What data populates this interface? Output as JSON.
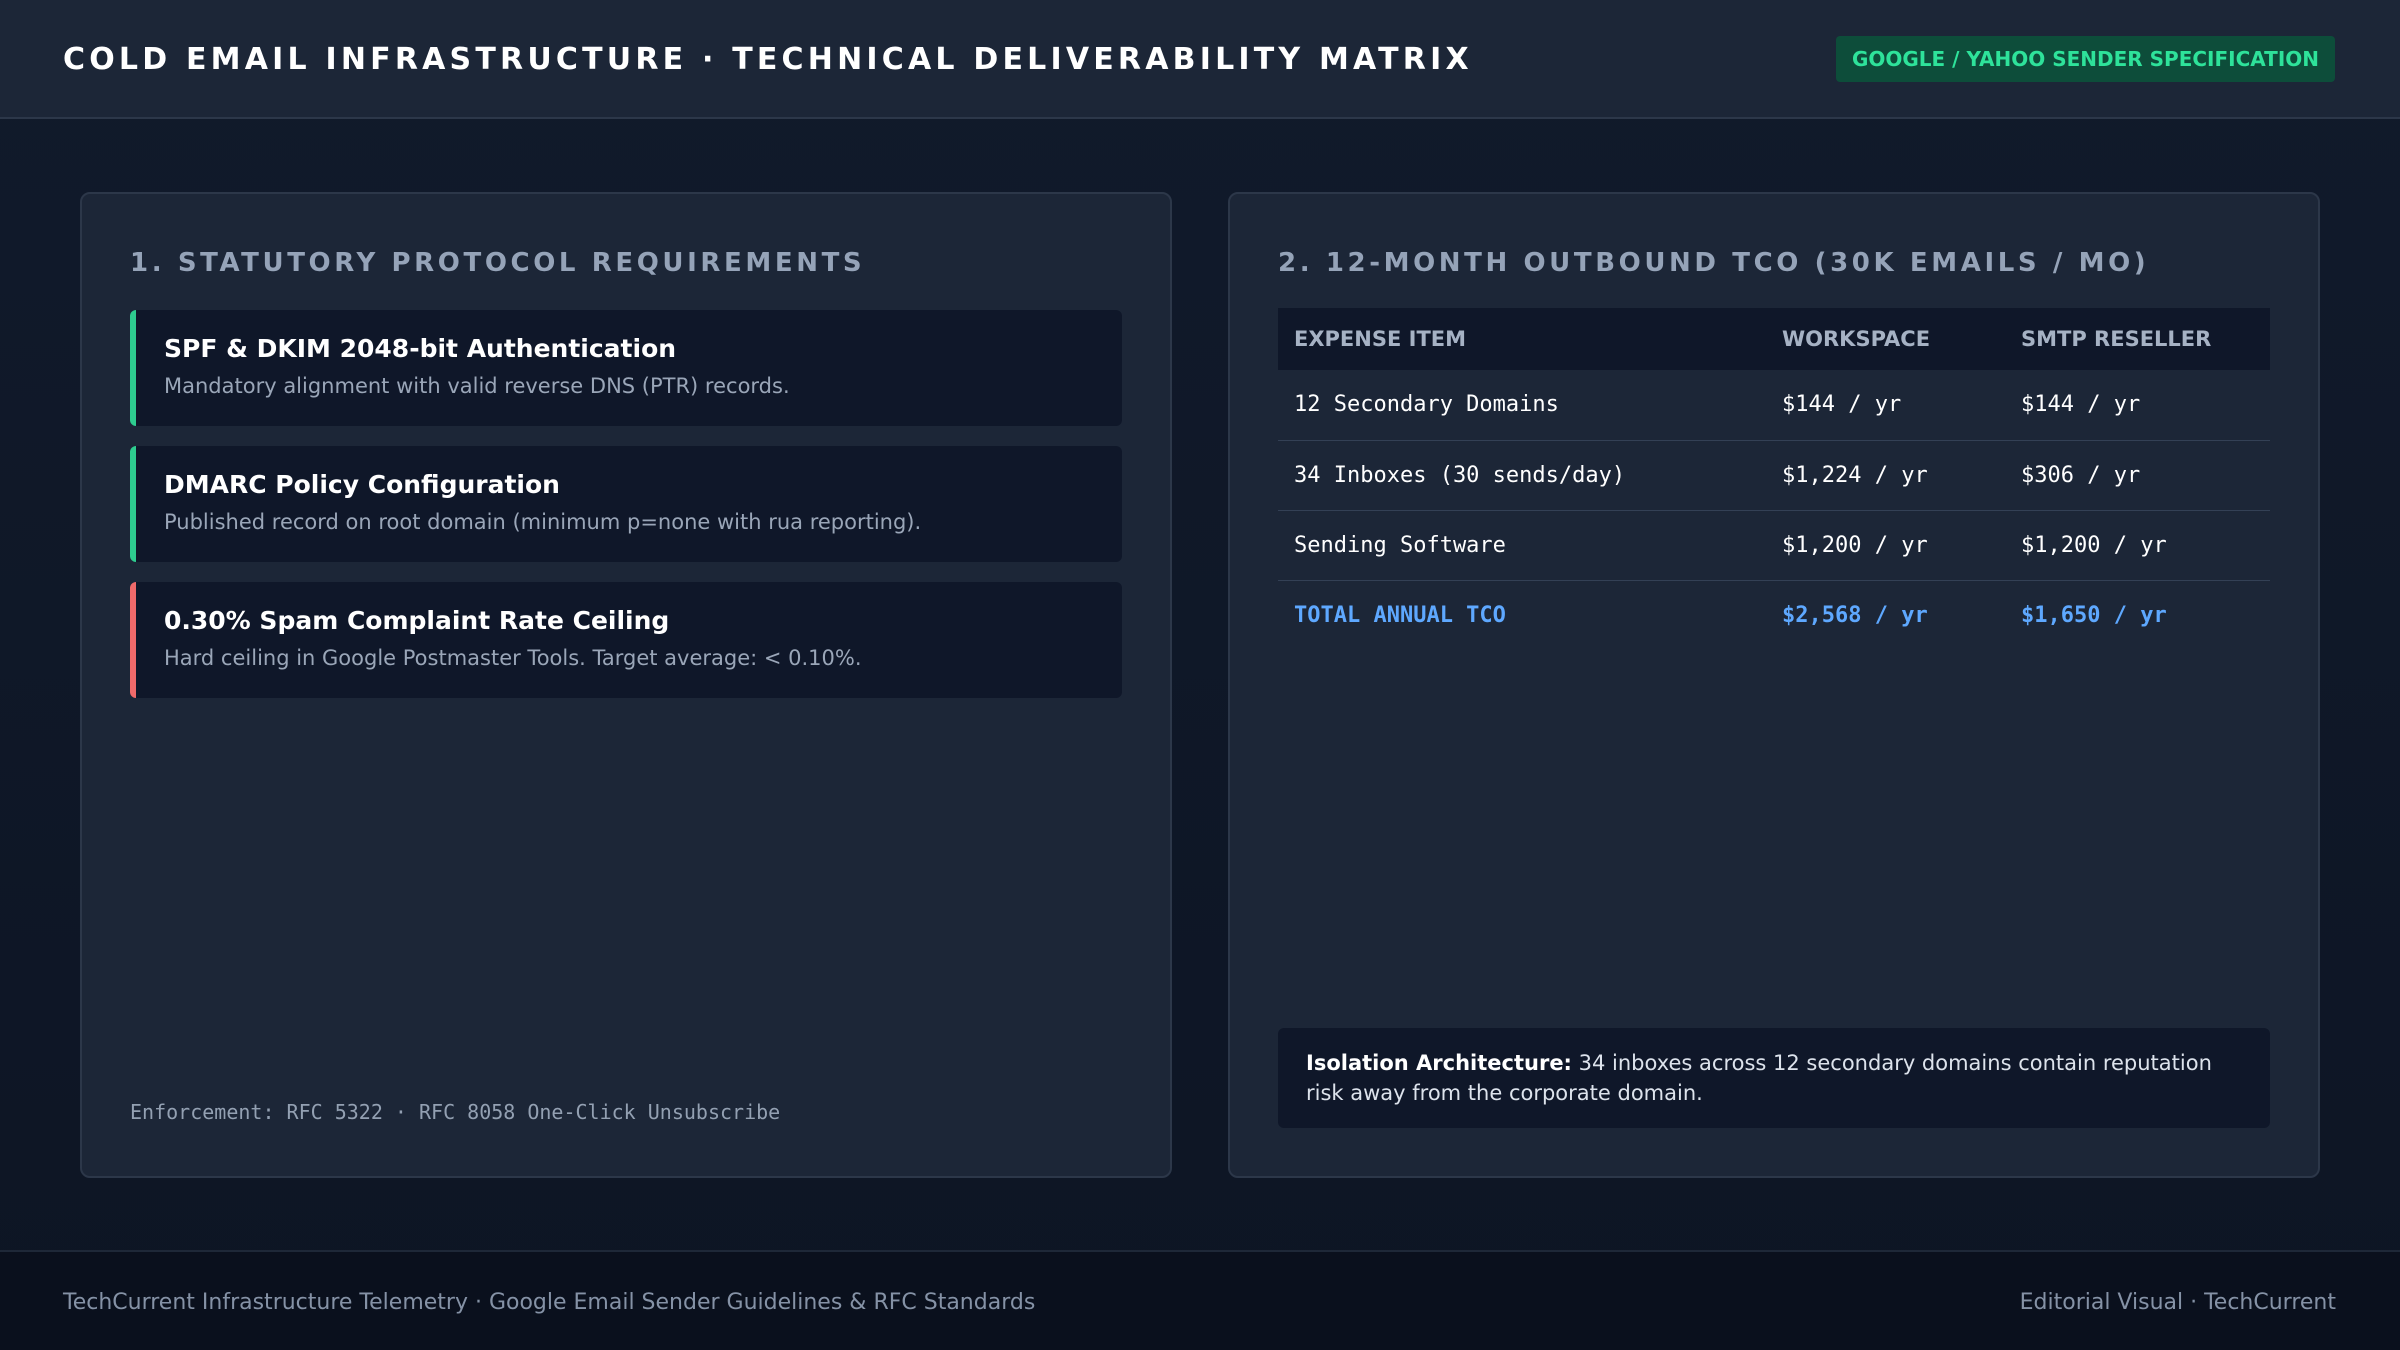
{
  "header": {
    "title": "COLD EMAIL INFRASTRUCTURE · TECHNICAL DELIVERABILITY MATRIX",
    "badge": "GOOGLE / YAHOO SENDER SPECIFICATION"
  },
  "left_panel": {
    "title": "1. STATUTORY PROTOCOL REQUIREMENTS",
    "requirements": [
      {
        "title": "SPF & DKIM 2048-bit Authentication",
        "description": "Mandatory alignment with valid reverse DNS (PTR) records.",
        "accent_color": "#2ecc8f"
      },
      {
        "title": "DMARC Policy Configuration",
        "description": "Published record on root domain (minimum p=none with rua reporting).",
        "accent_color": "#2ecc8f"
      },
      {
        "title": "0.30% Spam Complaint Rate Ceiling",
        "description": "Hard ceiling in Google Postmaster Tools. Target average: < 0.10%.",
        "accent_color": "#f06a6a"
      }
    ],
    "enforcement": "Enforcement: RFC 5322 · RFC 8058 One-Click Unsubscribe"
  },
  "right_panel": {
    "title": "2. 12-MONTH OUTBOUND TCO (30K EMAILS / MO)",
    "table": {
      "headers": [
        "EXPENSE ITEM",
        "WORKSPACE",
        "SMTP RESELLER"
      ],
      "rows": [
        [
          "12 Secondary Domains",
          "$144 / yr",
          "$144 / yr"
        ],
        [
          "34 Inboxes (30 sends/day)",
          "$1,224 / yr",
          "$306 / yr"
        ],
        [
          "Sending Software",
          "$1,200 / yr",
          "$1,200 / yr"
        ]
      ],
      "total": [
        "TOTAL ANNUAL TCO",
        "$2,568 / yr",
        "$1,650 / yr"
      ]
    },
    "note": {
      "label": "Isolation Architecture:",
      "text": " 34 inboxes across 12 secondary domains contain reputation risk away from the corporate domain."
    }
  },
  "footer": {
    "left": "TechCurrent Infrastructure Telemetry · Google Email Sender Guidelines & RFC Standards",
    "right": "Editorial Visual · TechCurrent"
  },
  "colors": {
    "accent_green": "#2ecc8f",
    "accent_red": "#f06a6a",
    "total_blue": "#5ea8ff",
    "badge_bg": "#0d4d3a",
    "badge_text": "#2ee29a"
  }
}
